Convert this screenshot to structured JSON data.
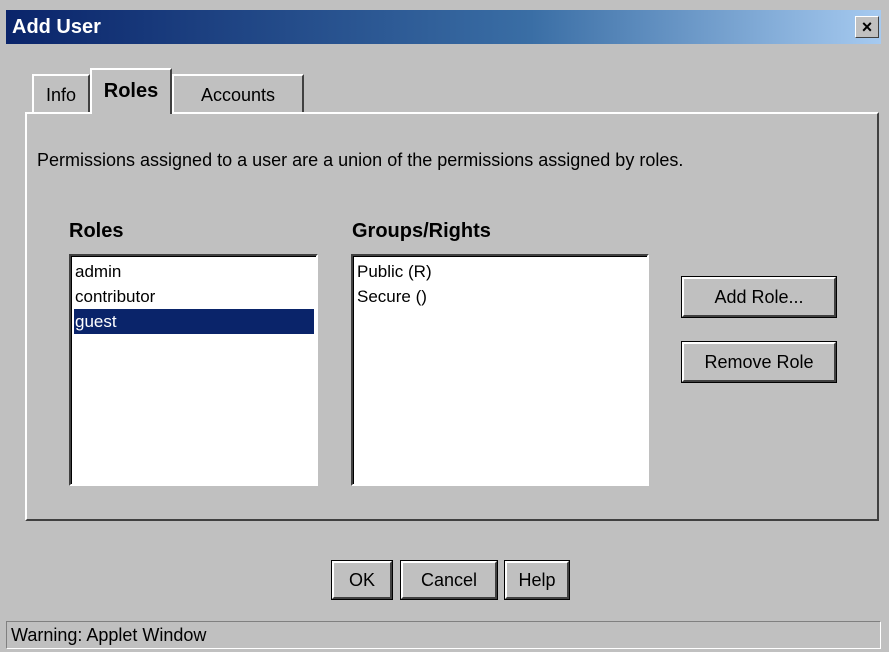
{
  "window": {
    "title": "Add User",
    "close_symbol": "×"
  },
  "tabs": [
    {
      "label": "Info",
      "active": false
    },
    {
      "label": "Roles",
      "active": true
    },
    {
      "label": "Accounts",
      "active": false
    }
  ],
  "panel": {
    "description": "Permissions assigned to a user are a union of the permissions assigned by roles.",
    "roles_label": "Roles",
    "groups_label": "Groups/Rights",
    "roles": [
      "admin",
      "contributor",
      "guest"
    ],
    "selected_role": "guest",
    "groups_rights": [
      "Public  (R)",
      "Secure  ()"
    ],
    "add_role_label": "Add Role...",
    "remove_role_label": "Remove Role"
  },
  "footer": {
    "ok_label": "OK",
    "cancel_label": "Cancel",
    "help_label": "Help"
  },
  "status": {
    "text": "Warning: Applet Window"
  }
}
